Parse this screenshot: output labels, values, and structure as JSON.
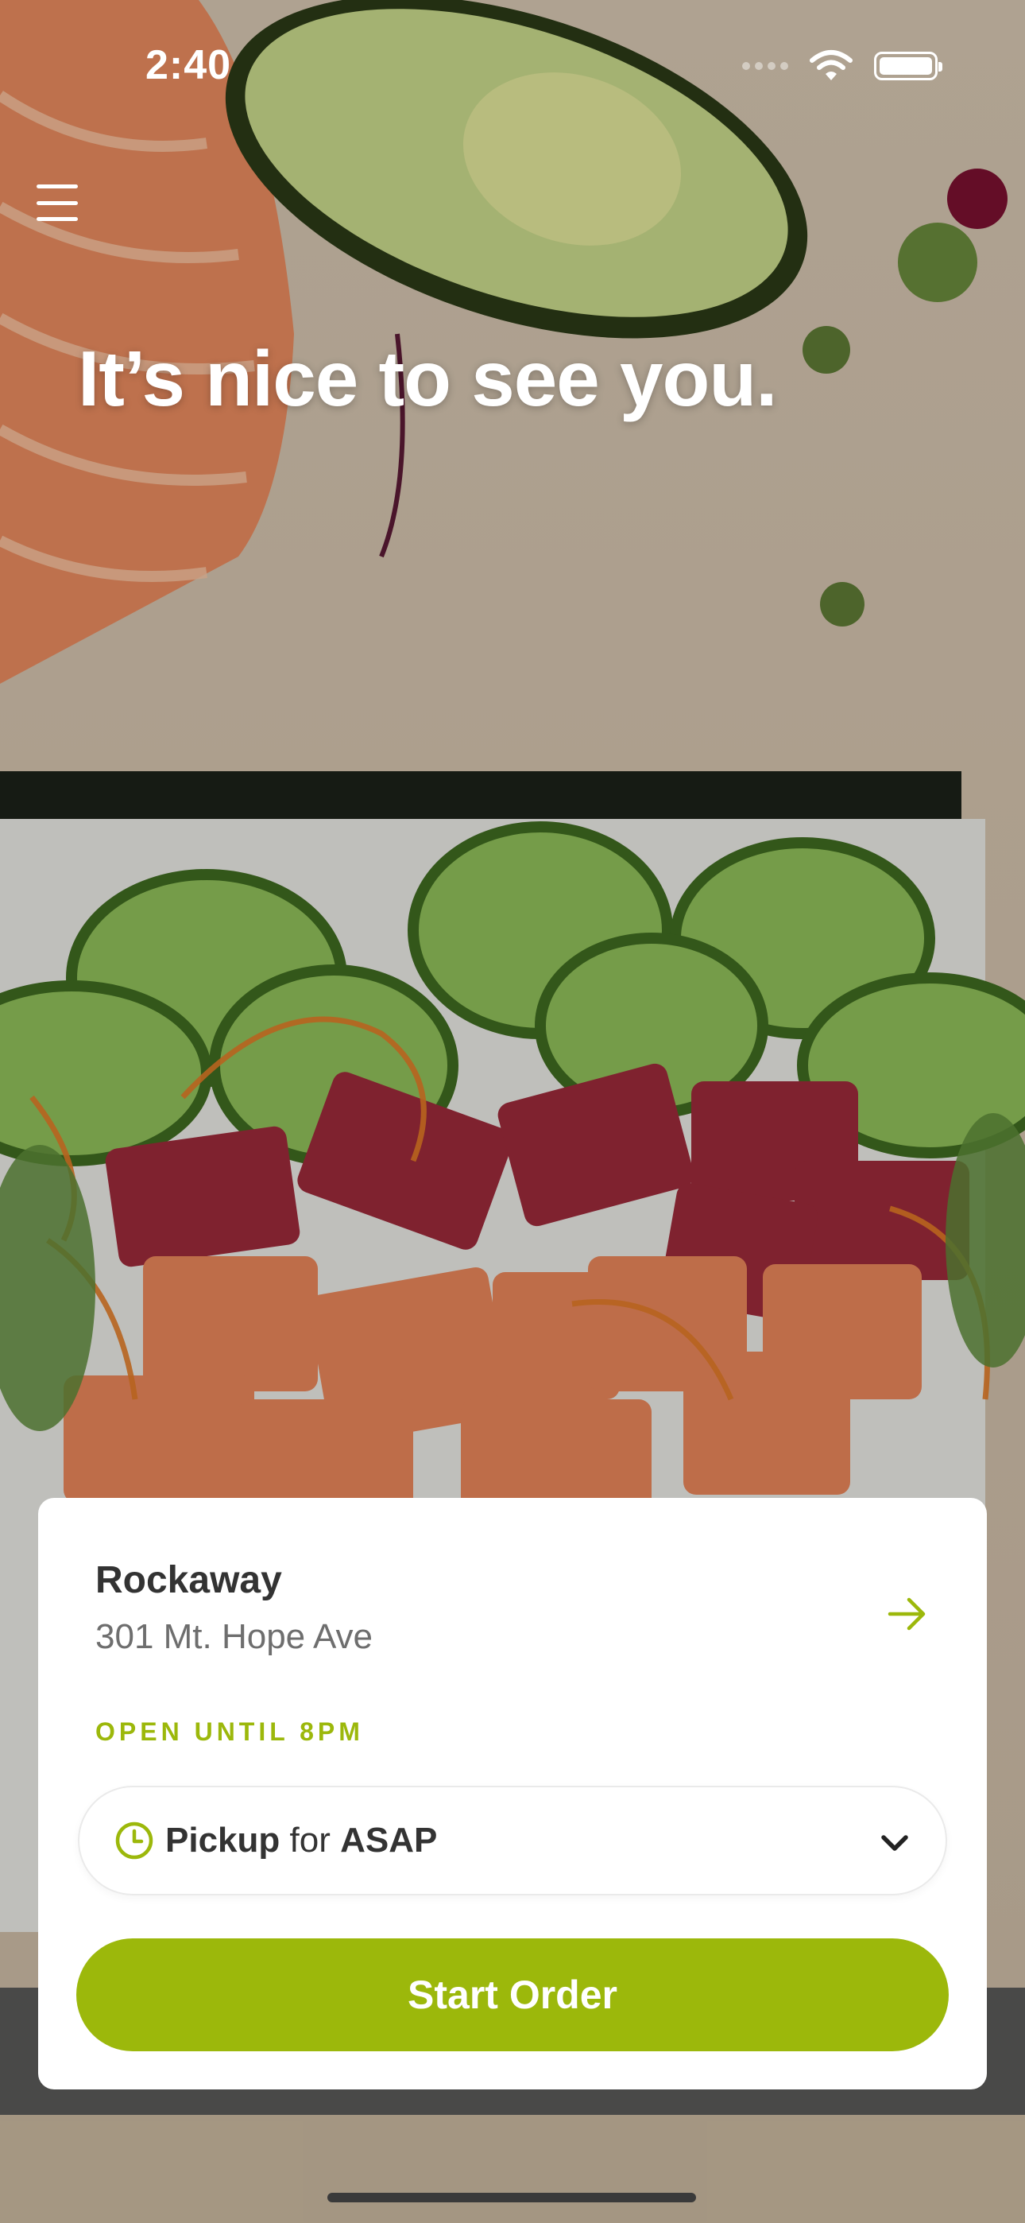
{
  "status_bar": {
    "time": "2:40",
    "icons": [
      "cellular-signal-icon",
      "wifi-icon",
      "battery-icon"
    ]
  },
  "header": {
    "menu_icon": "hamburger-menu-icon",
    "greeting": "It’s nice to see you."
  },
  "location": {
    "name": "Rockaway",
    "address": "301 Mt. Hope Ave",
    "hours": "OPEN UNTIL 8PM",
    "arrow_icon": "arrow-right-icon"
  },
  "order_mode": {
    "icon": "clock-icon",
    "mode": "Pickup",
    "connector": "for",
    "time": "ASAP",
    "dropdown_icon": "chevron-down-icon"
  },
  "actions": {
    "start_order": "Start Order"
  },
  "colors": {
    "accent": "#9cb80b",
    "text_primary": "#333333",
    "text_secondary": "#6e6e6e",
    "card_bg": "#ffffff"
  }
}
